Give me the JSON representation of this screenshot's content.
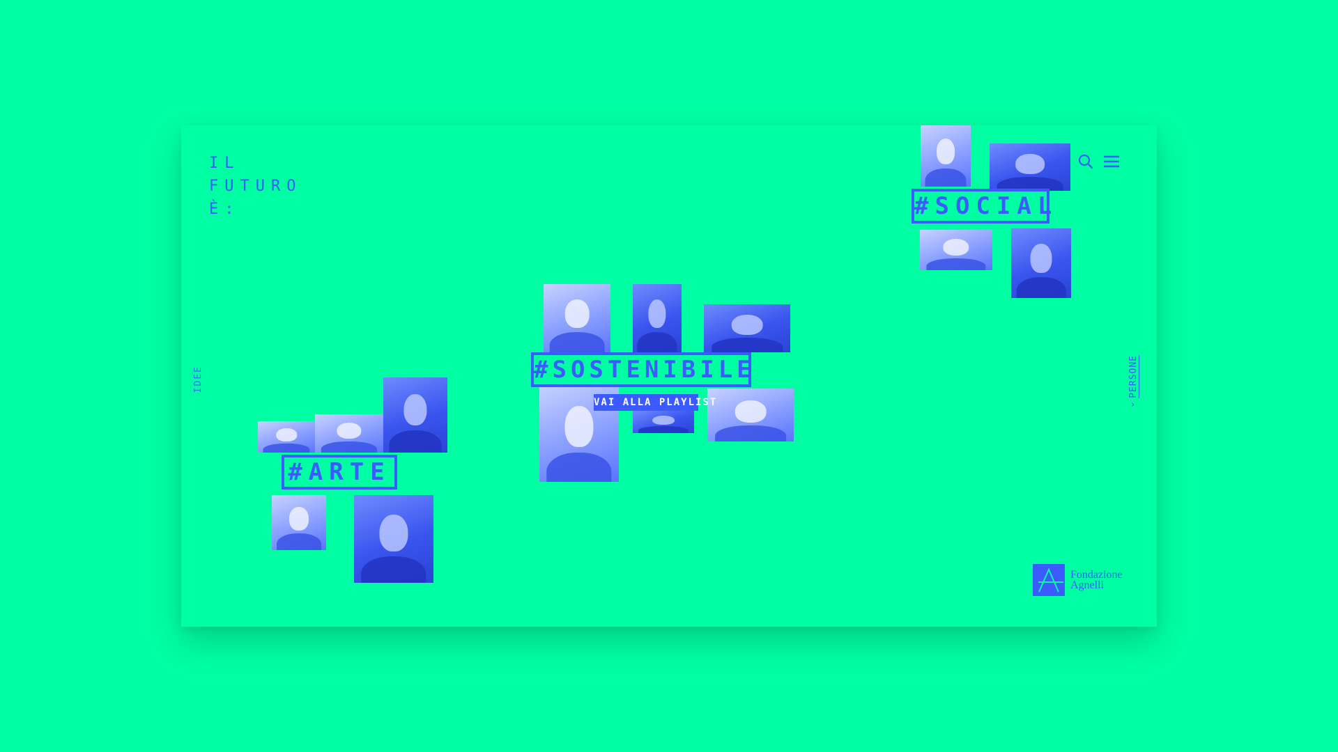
{
  "header": {
    "title_lines": [
      "IL",
      "FUTURO",
      "È:"
    ]
  },
  "side_nav": {
    "left_label": "IDEE",
    "right_label": "PERSONE",
    "right_arrow": "›"
  },
  "clusters": {
    "social": {
      "tag": "#SOCIAL"
    },
    "sostenibile": {
      "tag": "#SOSTENIBILE",
      "playlist_label": "VAI ALLA PLAYLIST"
    },
    "arte": {
      "tag": "#ARTE"
    }
  },
  "footer": {
    "logo_line1": "Fondazione",
    "logo_line2": "Agnelli"
  },
  "icons": {
    "search": "search-icon",
    "menu": "menu-icon",
    "logo": "fondazione-agnelli-logo"
  },
  "colors": {
    "background": "#00ffa3",
    "accent": "#3b5bff",
    "white": "#ffffff"
  }
}
